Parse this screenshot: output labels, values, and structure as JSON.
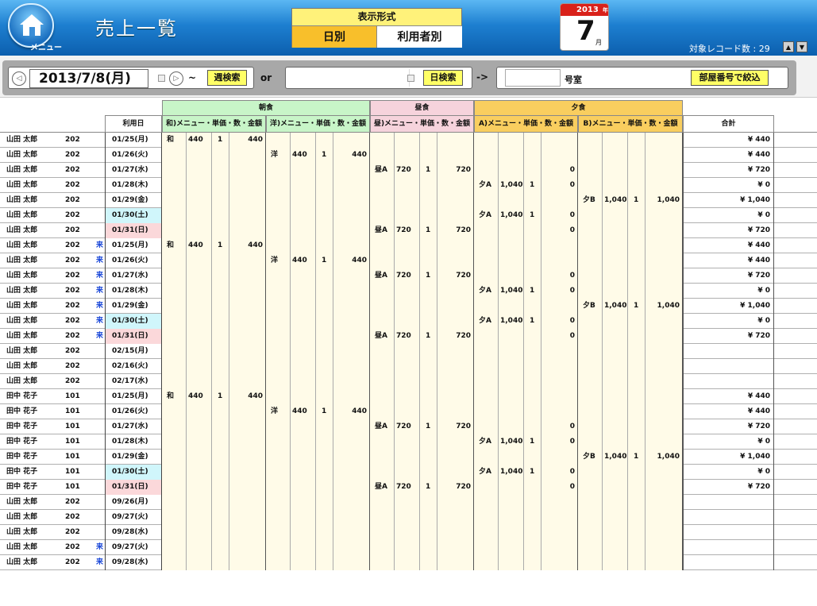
{
  "header": {
    "title": "売上一覧",
    "menu_label": "メニュー",
    "format_label": "表示形式",
    "tab_daily": "日別",
    "tab_user": "利用者別",
    "cal_year": "2013",
    "cal_year_suffix": "年",
    "cal_day": "7",
    "cal_month_suffix": "月",
    "record_count_label": "対象レコード数 : 29"
  },
  "toolbar": {
    "date": "2013/7/8(月)",
    "tilde": "~",
    "week_search": "週検索",
    "or": "or",
    "day_search": "日検索",
    "arrow": "->",
    "room_suffix": "号室",
    "room_filter": "部屋番号で絞込"
  },
  "columns": {
    "date": "利用日",
    "breakfast": "朝食",
    "lunch": "昼食",
    "dinner": "夕食",
    "total": "合計",
    "b_wa": "和)メニュー・単価・数・金額",
    "b_yo": "洋)メニュー・単価・数・金額",
    "l": "昼)メニュー・単価・数・金額",
    "d_a": "A)メニュー・単価・数・金額",
    "d_b": "B)メニュー・単価・数・金額"
  },
  "colors": {
    "breakfast": "#c8f5c8",
    "lunch": "#f6d3dc",
    "dinner": "#f9ce5f",
    "header_blue": "#1d7fd0",
    "cell_bg": "#fffbe8"
  },
  "rows": [
    {
      "name": "山田 太郎",
      "room": "202",
      "mark": "",
      "date": "01/25(月)",
      "day": "",
      "meal": "b1",
      "menu": "和",
      "price": "440",
      "qty": "1",
      "amt": "440",
      "amt2": "",
      "total": "¥ 440"
    },
    {
      "name": "山田 太郎",
      "room": "202",
      "mark": "",
      "date": "01/26(火)",
      "day": "",
      "meal": "b2",
      "menu": "洋",
      "price": "440",
      "qty": "1",
      "amt": "440",
      "amt2": "",
      "total": "¥ 440"
    },
    {
      "name": "山田 太郎",
      "room": "202",
      "mark": "",
      "date": "01/27(水)",
      "day": "",
      "meal": "l",
      "menu": "昼A",
      "price": "720",
      "qty": "1",
      "amt": "720",
      "amt2": "0",
      "total": "¥ 720"
    },
    {
      "name": "山田 太郎",
      "room": "202",
      "mark": "",
      "date": "01/28(木)",
      "day": "",
      "meal": "da",
      "menu": "夕A",
      "price": "1,040",
      "qty": "1",
      "amt": "0",
      "amt2": "",
      "total": "¥ 0"
    },
    {
      "name": "山田 太郎",
      "room": "202",
      "mark": "",
      "date": "01/29(金)",
      "day": "",
      "meal": "db",
      "menu": "夕B",
      "price": "1,040",
      "qty": "1",
      "amt": "1,040",
      "amt2": "",
      "total": "¥ 1,040"
    },
    {
      "name": "山田 太郎",
      "room": "202",
      "mark": "",
      "date": "01/30(土)",
      "day": "sat",
      "meal": "da",
      "menu": "夕A",
      "price": "1,040",
      "qty": "1",
      "amt": "0",
      "amt2": "",
      "total": "¥ 0"
    },
    {
      "name": "山田 太郎",
      "room": "202",
      "mark": "",
      "date": "01/31(日)",
      "day": "sun",
      "meal": "l",
      "menu": "昼A",
      "price": "720",
      "qty": "1",
      "amt": "720",
      "amt2": "0",
      "total": "¥ 720"
    },
    {
      "name": "山田 太郎",
      "room": "202",
      "mark": "来",
      "date": "01/25(月)",
      "day": "",
      "meal": "b1",
      "menu": "和",
      "price": "440",
      "qty": "1",
      "amt": "440",
      "amt2": "",
      "total": "¥ 440"
    },
    {
      "name": "山田 太郎",
      "room": "202",
      "mark": "来",
      "date": "01/26(火)",
      "day": "",
      "meal": "b2",
      "menu": "洋",
      "price": "440",
      "qty": "1",
      "amt": "440",
      "amt2": "",
      "total": "¥ 440"
    },
    {
      "name": "山田 太郎",
      "room": "202",
      "mark": "来",
      "date": "01/27(水)",
      "day": "",
      "meal": "l",
      "menu": "昼A",
      "price": "720",
      "qty": "1",
      "amt": "720",
      "amt2": "0",
      "total": "¥ 720"
    },
    {
      "name": "山田 太郎",
      "room": "202",
      "mark": "来",
      "date": "01/28(木)",
      "day": "",
      "meal": "da",
      "menu": "夕A",
      "price": "1,040",
      "qty": "1",
      "amt": "0",
      "amt2": "",
      "total": "¥ 0"
    },
    {
      "name": "山田 太郎",
      "room": "202",
      "mark": "来",
      "date": "01/29(金)",
      "day": "",
      "meal": "db",
      "menu": "夕B",
      "price": "1,040",
      "qty": "1",
      "amt": "1,040",
      "amt2": "",
      "total": "¥ 1,040"
    },
    {
      "name": "山田 太郎",
      "room": "202",
      "mark": "来",
      "date": "01/30(土)",
      "day": "sat",
      "meal": "da",
      "menu": "夕A",
      "price": "1,040",
      "qty": "1",
      "amt": "0",
      "amt2": "",
      "total": "¥ 0"
    },
    {
      "name": "山田 太郎",
      "room": "202",
      "mark": "来",
      "date": "01/31(日)",
      "day": "sun",
      "meal": "l",
      "menu": "昼A",
      "price": "720",
      "qty": "1",
      "amt": "720",
      "amt2": "0",
      "total": "¥ 720"
    },
    {
      "name": "山田 太郎",
      "room": "202",
      "mark": "",
      "date": "02/15(月)",
      "day": "",
      "meal": "",
      "menu": "",
      "price": "",
      "qty": "",
      "amt": "",
      "amt2": "",
      "total": ""
    },
    {
      "name": "山田 太郎",
      "room": "202",
      "mark": "",
      "date": "02/16(火)",
      "day": "",
      "meal": "",
      "menu": "",
      "price": "",
      "qty": "",
      "amt": "",
      "amt2": "",
      "total": ""
    },
    {
      "name": "山田 太郎",
      "room": "202",
      "mark": "",
      "date": "02/17(水)",
      "day": "",
      "meal": "",
      "menu": "",
      "price": "",
      "qty": "",
      "amt": "",
      "amt2": "",
      "total": ""
    },
    {
      "name": "田中 花子",
      "room": "101",
      "mark": "",
      "date": "01/25(月)",
      "day": "",
      "meal": "b1",
      "menu": "和",
      "price": "440",
      "qty": "1",
      "amt": "440",
      "amt2": "",
      "total": "¥ 440"
    },
    {
      "name": "田中 花子",
      "room": "101",
      "mark": "",
      "date": "01/26(火)",
      "day": "",
      "meal": "b2",
      "menu": "洋",
      "price": "440",
      "qty": "1",
      "amt": "440",
      "amt2": "",
      "total": "¥ 440"
    },
    {
      "name": "田中 花子",
      "room": "101",
      "mark": "",
      "date": "01/27(水)",
      "day": "",
      "meal": "l",
      "menu": "昼A",
      "price": "720",
      "qty": "1",
      "amt": "720",
      "amt2": "0",
      "total": "¥ 720"
    },
    {
      "name": "田中 花子",
      "room": "101",
      "mark": "",
      "date": "01/28(木)",
      "day": "",
      "meal": "da",
      "menu": "夕A",
      "price": "1,040",
      "qty": "1",
      "amt": "0",
      "amt2": "",
      "total": "¥ 0"
    },
    {
      "name": "田中 花子",
      "room": "101",
      "mark": "",
      "date": "01/29(金)",
      "day": "",
      "meal": "db",
      "menu": "夕B",
      "price": "1,040",
      "qty": "1",
      "amt": "1,040",
      "amt2": "",
      "total": "¥ 1,040"
    },
    {
      "name": "田中 花子",
      "room": "101",
      "mark": "",
      "date": "01/30(土)",
      "day": "sat",
      "meal": "da",
      "menu": "夕A",
      "price": "1,040",
      "qty": "1",
      "amt": "0",
      "amt2": "",
      "total": "¥ 0"
    },
    {
      "name": "田中 花子",
      "room": "101",
      "mark": "",
      "date": "01/31(日)",
      "day": "sun",
      "meal": "l",
      "menu": "昼A",
      "price": "720",
      "qty": "1",
      "amt": "720",
      "amt2": "0",
      "total": "¥ 720"
    },
    {
      "name": "山田 太郎",
      "room": "202",
      "mark": "",
      "date": "09/26(月)",
      "day": "",
      "meal": "",
      "menu": "",
      "price": "",
      "qty": "",
      "amt": "",
      "amt2": "",
      "total": ""
    },
    {
      "name": "山田 太郎",
      "room": "202",
      "mark": "",
      "date": "09/27(火)",
      "day": "",
      "meal": "",
      "menu": "",
      "price": "",
      "qty": "",
      "amt": "",
      "amt2": "",
      "total": ""
    },
    {
      "name": "山田 太郎",
      "room": "202",
      "mark": "",
      "date": "09/28(水)",
      "day": "",
      "meal": "",
      "menu": "",
      "price": "",
      "qty": "",
      "amt": "",
      "amt2": "",
      "total": ""
    },
    {
      "name": "山田 太郎",
      "room": "202",
      "mark": "来",
      "date": "09/27(火)",
      "day": "",
      "meal": "",
      "menu": "",
      "price": "",
      "qty": "",
      "amt": "",
      "amt2": "",
      "total": ""
    },
    {
      "name": "山田 太郎",
      "room": "202",
      "mark": "来",
      "date": "09/28(水)",
      "day": "",
      "meal": "",
      "menu": "",
      "price": "",
      "qty": "",
      "amt": "",
      "amt2": "",
      "total": ""
    }
  ]
}
